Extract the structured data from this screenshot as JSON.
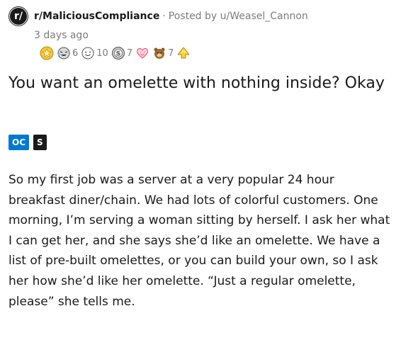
{
  "post": {
    "subreddit_icon": "r/",
    "subreddit": "r/MaliciousCompliance",
    "separator": "·",
    "posted_by": "Posted by u/Weasel_Cannon",
    "time": "3 days ago",
    "awards": [
      {
        "icon": "gold-star-award-icon",
        "count": ""
      },
      {
        "icon": "crying-laughing-award-icon",
        "count": "6"
      },
      {
        "icon": "wholesome-award-icon",
        "count": "10"
      },
      {
        "icon": "silver-award-icon",
        "count": "7"
      },
      {
        "icon": "heart-eyes-award-icon",
        "count": ""
      },
      {
        "icon": "bear-award-icon",
        "count": "7"
      },
      {
        "icon": "golden-up-award-icon",
        "count": ""
      }
    ],
    "title": "You want an omelette with nothing inside? Okay",
    "flairs": {
      "oc": "OC",
      "s": "S"
    },
    "body": "So my first job was a server at a very popular 24 hour breakfast diner/chain. We had lots of colorful customers. One morning, I’m serving a woman sitting by herself. I ask her what I can get her, and she says she’d like an omelette. We have a list of pre-built omelettes, or you can build your own, so I ask her how she’d like her omelette. “Just a regular omelette, please” she tells me."
  },
  "colors": {
    "accent": "#0079d3",
    "text": "#1a1a1b",
    "meta": "#7c7c7c"
  }
}
